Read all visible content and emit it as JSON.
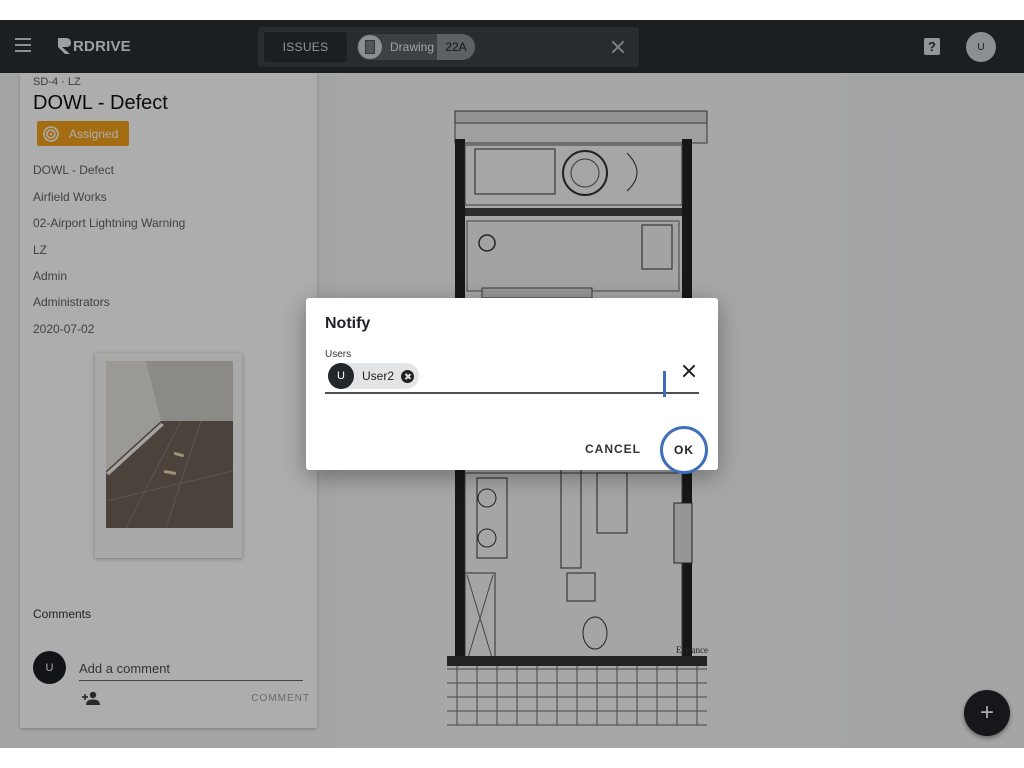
{
  "appbar": {
    "brand": "RDRIVE",
    "tabs": {
      "issues_label": "ISSUES",
      "drawing_label": "Drawing",
      "drawing_number": "22A"
    },
    "user_initial": "U",
    "help_glyph": "?"
  },
  "issue": {
    "breadcrumb": "SD-4 · LZ",
    "title": "DOWL - Defect",
    "status": "Assigned",
    "status_color": "#f4a11d",
    "details": [
      "DOWL - Defect",
      "Airfield Works",
      "02-Airport Lightning Warning",
      "LZ",
      "Admin",
      "Administrators",
      "2020-07-02"
    ]
  },
  "comments": {
    "label": "Comments",
    "avatar_initial": "U",
    "placeholder": "Add a comment",
    "button": "COMMENT"
  },
  "fab_glyph": "+",
  "dialog": {
    "title": "Notify",
    "users_label": "Users",
    "selected_users": [
      {
        "initial": "U",
        "name": "User2"
      }
    ],
    "cancel": "CANCEL",
    "ok": "OK"
  },
  "drawing_text": {
    "entrance": "Entrance"
  }
}
